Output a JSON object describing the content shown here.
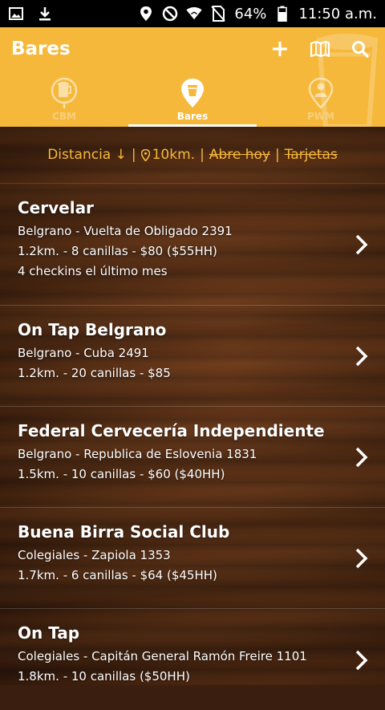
{
  "status_bar": {
    "battery": "64%",
    "time": "11:50 a.m.",
    "icons": [
      "image-icon",
      "download-icon",
      "location-icon",
      "block-icon",
      "wifi-icon",
      "no-sim-icon",
      "battery-icon"
    ]
  },
  "header": {
    "title": "Bares",
    "actions": [
      "add-icon",
      "map-icon",
      "search-icon"
    ],
    "accent_color": "#f6b83a"
  },
  "tabs": [
    {
      "label": "CBM",
      "icon": "beer-mug-icon",
      "active": false
    },
    {
      "label": "Bares",
      "icon": "bar-pin-icon",
      "active": true
    },
    {
      "label": "PWM",
      "icon": "person-pin-icon",
      "active": false
    }
  ],
  "filters": {
    "distance": "Distancia ↓",
    "radius": "10km.",
    "open_today": "Abre hoy",
    "cards": "Tarjetas"
  },
  "bars": [
    {
      "name": "Cervelar",
      "address": "Belgrano - Vuelta de Obligado 2391",
      "details": "1.2km. - 8 canillas - $80 ($55HH)",
      "extra": "4 checkins el último mes"
    },
    {
      "name": "On Tap Belgrano",
      "address": "Belgrano - Cuba 2491",
      "details": "1.2km. - 20 canillas - $85",
      "extra": ""
    },
    {
      "name": "Federal Cervecería Independiente",
      "address": "Belgrano - Republica de Eslovenia 1831",
      "details": "1.5km. - 10 canillas - $60 ($40HH)",
      "extra": ""
    },
    {
      "name": "Buena Birra Social Club",
      "address": "Colegiales - Zapiola 1353",
      "details": "1.7km. - 6 canillas - $64 ($45HH)",
      "extra": ""
    },
    {
      "name": "On Tap",
      "address": "Colegiales - Capitán General Ramón Freire 1101",
      "details": "1.8km. - 10 canillas ($50HH)",
      "extra": ""
    }
  ]
}
